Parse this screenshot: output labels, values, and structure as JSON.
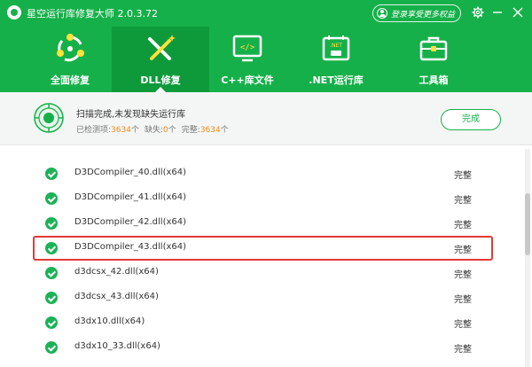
{
  "app": {
    "title": "星空运行库修复大师 2.0.3.72",
    "login_label": "登录享受更多权益"
  },
  "window": {
    "settings_icon": "gear-icon",
    "minimize_icon": "minimize-icon",
    "close_icon": "close-icon"
  },
  "tabs": [
    {
      "label": "全面修复",
      "icon": "full-repair-icon",
      "active": false
    },
    {
      "label": "DLL修复",
      "icon": "dll-repair-icon",
      "active": true
    },
    {
      "label": "C++库文件",
      "icon": "cpp-library-icon",
      "active": false
    },
    {
      "label": ".NET运行库",
      "icon": "dotnet-runtime-icon",
      "active": false
    },
    {
      "label": "工具箱",
      "icon": "toolbox-icon",
      "active": false
    }
  ],
  "status": {
    "title": "扫描完成,未发现缺失运行库",
    "detected_label": "已检测项:",
    "detected_count": "3634",
    "detected_unit": "个",
    "missing_label": "缺失:",
    "missing_count": "0",
    "missing_unit": "个",
    "complete_label": "完整:",
    "complete_count": "3634",
    "complete_unit": "个",
    "done_button": "完成"
  },
  "files": [
    {
      "name": "D3DCompiler_40.dll(x64)",
      "state": "完整"
    },
    {
      "name": "D3DCompiler_41.dll(x64)",
      "state": "完整"
    },
    {
      "name": "D3DCompiler_42.dll(x64)",
      "state": "完整"
    },
    {
      "name": "D3DCompiler_43.dll(x64)",
      "state": "完整",
      "highlighted": true
    },
    {
      "name": "d3dcsx_42.dll(x64)",
      "state": "完整"
    },
    {
      "name": "d3dcsx_43.dll(x64)",
      "state": "完整"
    },
    {
      "name": "d3dx10.dll(x64)",
      "state": "完整"
    },
    {
      "name": "d3dx10_33.dll(x64)",
      "state": "完整"
    }
  ],
  "colors": {
    "brand_green": "#16b04a",
    "active_tab": "#0e9a3b",
    "check_green": "#1cb257",
    "count_orange": "#f08a1c",
    "highlight_red": "#e53935"
  }
}
